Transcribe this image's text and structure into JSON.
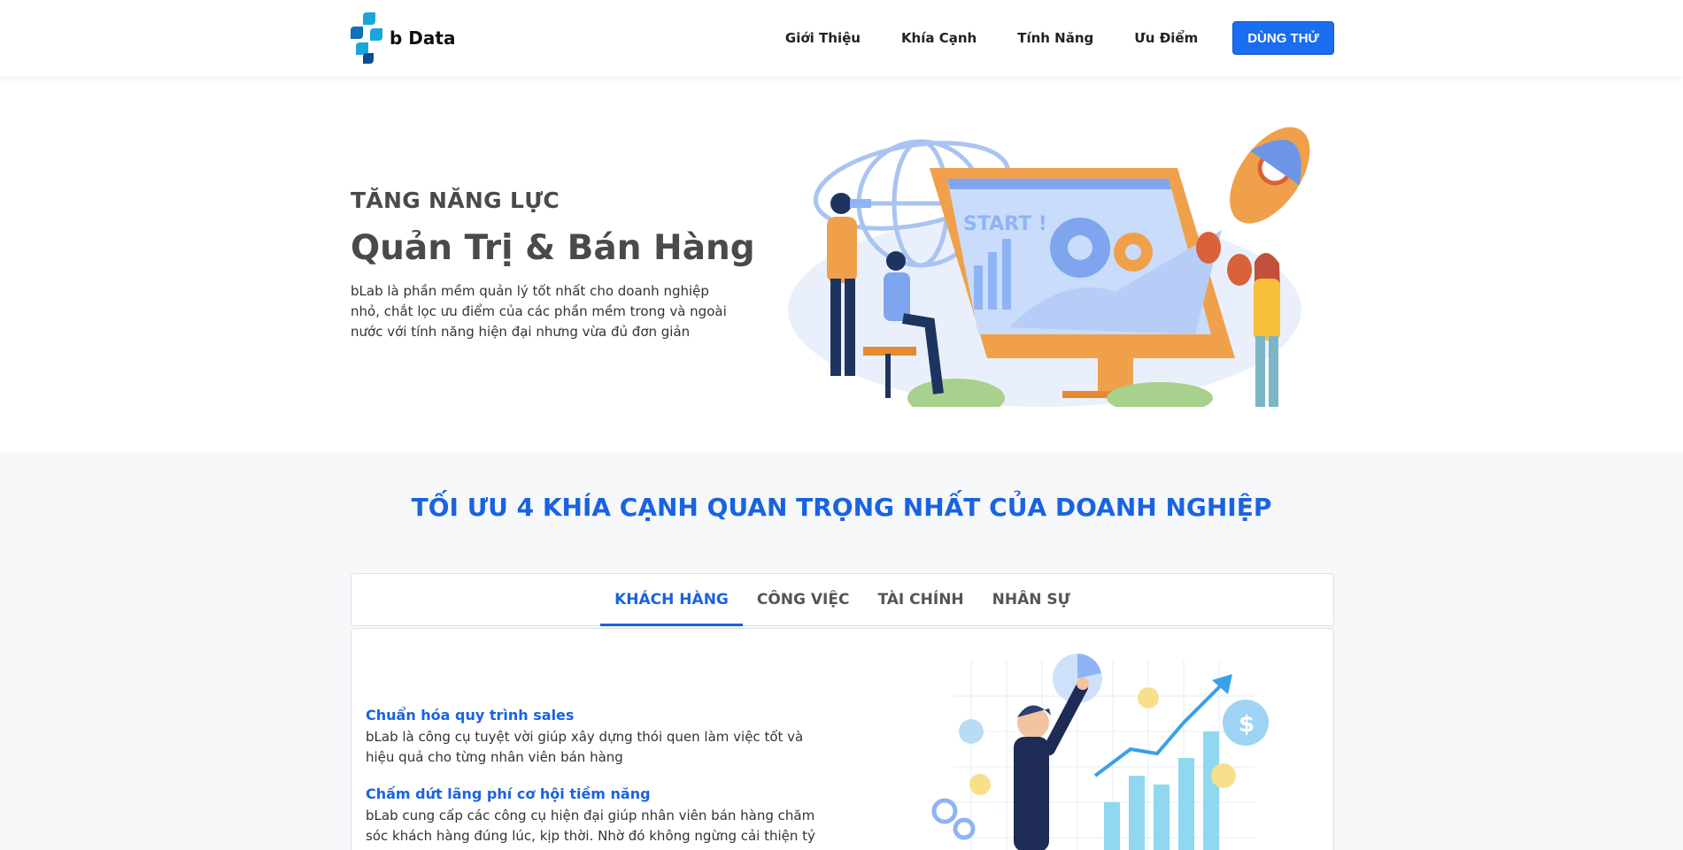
{
  "header": {
    "logo_text": "b Data",
    "nav": [
      "Giới Thiệu",
      "Khía Cạnh",
      "Tính Năng",
      "Ưu Điểm"
    ],
    "cta_label": "DÙNG THỬ"
  },
  "hero": {
    "kicker": "TĂNG NĂNG LỰC",
    "title": "Quản Trị & Bán Hàng",
    "description": "bLab là phần mềm quản lý tốt nhất cho doanh nghiệp nhỏ, chắt lọc ưu điểm của các phần mềm trong và ngoài nước với tính năng hiện đại nhưng vừa đủ đơn giản",
    "screen_text": "START !"
  },
  "aspects": {
    "title": "TỐI ƯU 4 KHÍA CẠNH QUAN TRỌNG NHẤT CỦA DOANH NGHIỆP",
    "tabs": [
      "KHÁCH HÀNG",
      "CÔNG VIỆC",
      "TÀI CHÍNH",
      "NHÂN SỰ"
    ],
    "active_tab": "KHÁCH HÀNG",
    "features": [
      {
        "title": "Chuẩn hóa quy trình sales",
        "description": "bLab là công cụ tuyệt vời giúp xây dựng thói quen làm việc tốt và hiệu quả cho từng nhân viên bán hàng"
      },
      {
        "title": "Chấm dứt lãng phí cơ hội tiềm năng",
        "description": "bLab cung cấp các công cụ hiện đại giúp nhân viên bán hàng chăm sóc khách hàng đúng lúc, kịp thời. Nhờ đó không ngừng cải thiện tỷ"
      }
    ]
  },
  "colors": {
    "accent": "#1a63e0",
    "cta": "#1a6cf0",
    "illustration_orange": "#f0a04b",
    "illustration_blue": "#8fb4f5"
  }
}
